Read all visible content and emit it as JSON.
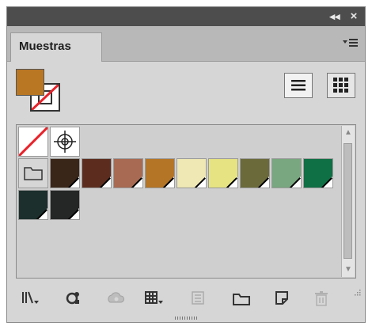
{
  "panel": {
    "collapse_glyph": "◂◂",
    "close_glyph": "×",
    "tab_label": "Muestras"
  },
  "fill_stroke": {
    "fill_color": "#b97623",
    "stroke_color": "none"
  },
  "view_buttons": [
    {
      "name": "list-view-icon",
      "selected": false
    },
    {
      "name": "grid-view-icon",
      "selected": true
    }
  ],
  "swatches": {
    "special": [
      "none-swatch",
      "registration-swatch"
    ],
    "folder": "color-group-folder",
    "colors": [
      "#3a2618",
      "#5c2d1e",
      "#a86a52",
      "#b47526",
      "#efe7b4",
      "#e6e382",
      "#6b6a3a",
      "#79a77f",
      "#0f6f45",
      "#1c2f2c",
      "#252626"
    ]
  },
  "bottom_icons": [
    "swatch-libraries-menu-icon",
    "show-swatch-kinds-icon",
    "cc-libraries-icon",
    "swatch-options-menu-icon",
    "color-group-options-icon",
    "new-color-group-icon",
    "new-swatch-icon",
    "delete-swatch-icon"
  ]
}
